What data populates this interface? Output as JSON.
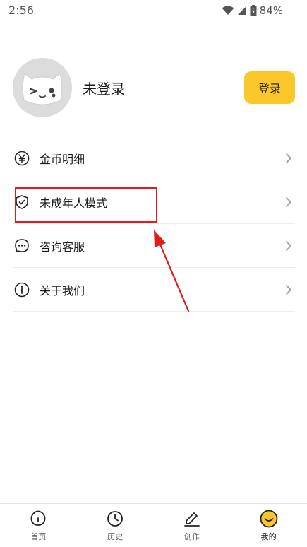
{
  "status_bar": {
    "time": "2:56",
    "battery": "84%",
    "icons": [
      "wifi-icon",
      "signal-icon",
      "battery-icon"
    ]
  },
  "profile": {
    "name": "未登录",
    "login_label": "登录",
    "avatar_icon": "cat-avatar-icon"
  },
  "menu": {
    "items": [
      {
        "label": "金币明细",
        "icon": "yen-coin-icon"
      },
      {
        "label": "未成年人模式",
        "icon": "shield-check-icon"
      },
      {
        "label": "咨询客服",
        "icon": "chat-bubble-icon"
      },
      {
        "label": "关于我们",
        "icon": "info-icon"
      }
    ]
  },
  "bottom_nav": {
    "items": [
      {
        "label": "首页",
        "icon": "home-icon"
      },
      {
        "label": "历史",
        "icon": "clock-icon"
      },
      {
        "label": "创作",
        "icon": "pencil-icon"
      },
      {
        "label": "我的",
        "icon": "smiley-icon",
        "active": true
      }
    ]
  },
  "colors": {
    "accent": "#fcc72b",
    "annotation": "#e21b1b",
    "avatar_bg": "#dcdcdc",
    "divider": "#ececec"
  }
}
